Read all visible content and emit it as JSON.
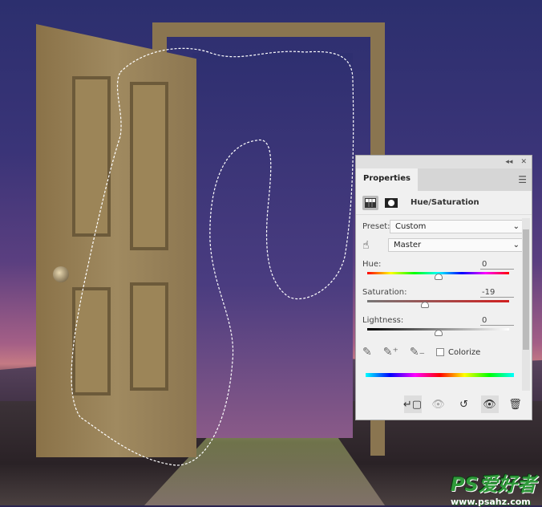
{
  "panel": {
    "title": "Properties",
    "adjustment": "Hue/Saturation",
    "preset_label": "Preset:",
    "preset_value": "Custom",
    "channel_value": "Master",
    "hue": {
      "label": "Hue:",
      "value": "0",
      "range": [
        -180,
        180
      ]
    },
    "saturation": {
      "label": "Saturation:",
      "value": "-19",
      "range": [
        -100,
        100
      ]
    },
    "lightness": {
      "label": "Lightness:",
      "value": "0",
      "range": [
        -100,
        100
      ]
    },
    "colorize_label": "Colorize",
    "colorize_checked": false,
    "collapse_glyph": "◂◂",
    "close_glyph": "✕"
  },
  "watermark": {
    "logo": "PS爱好者",
    "url": "www.psahz.com"
  }
}
